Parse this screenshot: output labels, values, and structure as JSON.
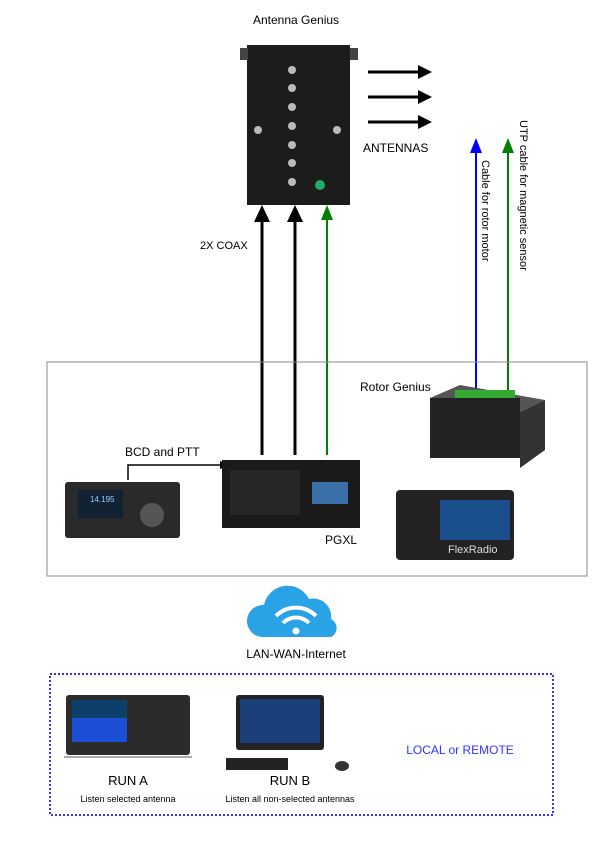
{
  "title": "Antenna Genius",
  "labels": {
    "antennas": "ANTENNAS",
    "coax": "2X COAX",
    "rotor_cable": "Cable for rotor motor",
    "utp_cable": "UTP cable for magnetic sensor",
    "rotor_genius": "Rotor Genius",
    "bcd_ptt": "BCD and PTT",
    "pgxl": "PGXL",
    "flexradio": "FlexRadio",
    "network": "LAN-WAN-Internet",
    "run_a": "RUN A",
    "run_a_desc": "Listen selected antenna",
    "run_b": "RUN B",
    "run_b_desc": "Listen all non-selected antennas",
    "local_remote": "LOCAL or REMOTE"
  },
  "colors": {
    "rotor_cable": "#0000ff",
    "utp_cable": "#008000",
    "coax": "#000000",
    "local_remote": "#3333ff",
    "cloud": "#2aa3e6"
  }
}
